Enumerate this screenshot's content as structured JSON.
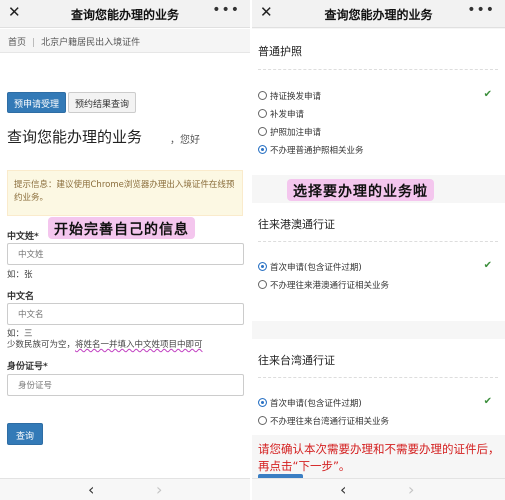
{
  "left": {
    "topbar": {
      "close": "✕",
      "title": "查询您能办理的业务",
      "more": "•••"
    },
    "breadcrumb": [
      "首页",
      "北京户籍居民出入境证件"
    ],
    "tabs": [
      {
        "label": "预申请受理",
        "active": true
      },
      {
        "label": "预约结果查询",
        "active": false
      }
    ],
    "page_title": "查询您能办理的业务",
    "greeting": "，您好",
    "tip": "提示信息：建议使用Chrome浏览器办理出入境证件在线预约业务。",
    "sticker": "开始完善自己的信息",
    "surname": {
      "label": "中文姓*",
      "placeholder": "中文姓",
      "example": "如：张"
    },
    "given": {
      "label": "中文名",
      "placeholder": "中文名",
      "example": "如：三"
    },
    "note_plain": "少数民族可为空，",
    "note_wavy": "将姓名一并填入中文姓项目中即可",
    "idcard": {
      "label": "身份证号*",
      "placeholder": "身份证号"
    },
    "query_button": "查询"
  },
  "right": {
    "topbar": {
      "close": "✕",
      "title": "查询您能办理的业务",
      "more": "•••"
    },
    "passport": {
      "title": "普通护照",
      "options": [
        {
          "label": "持证换发申请",
          "checked": false
        },
        {
          "label": "补发申请",
          "checked": false
        },
        {
          "label": "护照加注申请",
          "checked": false
        },
        {
          "label": "不办理普通护照相关业务",
          "checked": true
        }
      ]
    },
    "sticker": "选择要办理的业务啦",
    "hk_macao": {
      "title": "往来港澳通行证",
      "options": [
        {
          "label": "首次申请(包含证件过期)",
          "checked": true
        },
        {
          "label": "不办理往来港澳通行证相关业务",
          "checked": false
        }
      ]
    },
    "taiwan": {
      "title": "往来台湾通行证",
      "options": [
        {
          "label": "首次申请(包含证件过期)",
          "checked": true
        },
        {
          "label": "不办理往来台湾通行证相关业务",
          "checked": false
        }
      ]
    },
    "red_note": "请您确认本次需要办理和不需要办理的证件后，再点击“下一步”。",
    "check_mark": "✔"
  },
  "nav": {
    "back": "‹",
    "forward": "›"
  },
  "colors": {
    "primary": "#337ab7",
    "sticker_bg": "#f4c6ee",
    "warn_bg": "#fcf8e3",
    "red_note": "#d42020",
    "check": "#3c8f3c"
  }
}
